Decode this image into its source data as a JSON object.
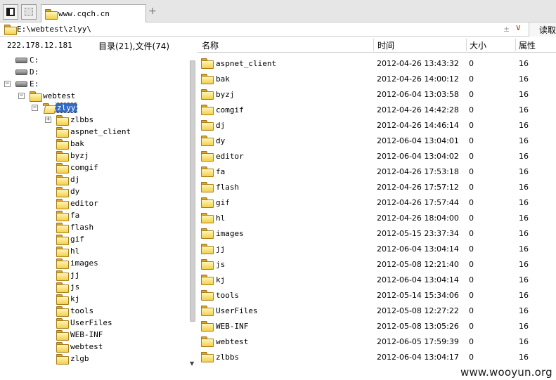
{
  "tab": {
    "label": "www.cqch.cn",
    "add_symbol": "+"
  },
  "address": {
    "path": "E:\\webtest\\zlyy\\",
    "pm_symbol": "±",
    "dropdown_symbol": "∨",
    "read_button": "读取"
  },
  "left": {
    "ip": "222.178.12.181",
    "counts": "目录(21),文件(74)",
    "drives": [
      {
        "label": "C:",
        "expanded": false
      },
      {
        "label": "D:",
        "expanded": false
      },
      {
        "label": "E:",
        "expanded": true
      }
    ],
    "webtest_label": "webtest",
    "selected_folder": "zlyy",
    "children": [
      "zlbbs",
      "aspnet_client",
      "bak",
      "byzj",
      "comgif",
      "dj",
      "dy",
      "editor",
      "fa",
      "flash",
      "gif",
      "hl",
      "images",
      "jj",
      "js",
      "kj",
      "tools",
      "UserFiles",
      "WEB-INF",
      "webtest",
      "zlgb"
    ]
  },
  "columns": {
    "name": "名称",
    "time": "时间",
    "size": "大小",
    "attr": "属性"
  },
  "files": [
    {
      "name": "aspnet_client",
      "time": "2012-04-26 13:43:32",
      "size": "0",
      "attr": "16"
    },
    {
      "name": "bak",
      "time": "2012-04-26 14:00:12",
      "size": "0",
      "attr": "16"
    },
    {
      "name": "byzj",
      "time": "2012-06-04 13:03:58",
      "size": "0",
      "attr": "16"
    },
    {
      "name": "comgif",
      "time": "2012-04-26 14:42:28",
      "size": "0",
      "attr": "16"
    },
    {
      "name": "dj",
      "time": "2012-04-26 14:46:14",
      "size": "0",
      "attr": "16"
    },
    {
      "name": "dy",
      "time": "2012-06-04 13:04:01",
      "size": "0",
      "attr": "16"
    },
    {
      "name": "editor",
      "time": "2012-06-04 13:04:02",
      "size": "0",
      "attr": "16"
    },
    {
      "name": "fa",
      "time": "2012-04-26 17:53:18",
      "size": "0",
      "attr": "16"
    },
    {
      "name": "flash",
      "time": "2012-04-26 17:57:12",
      "size": "0",
      "attr": "16"
    },
    {
      "name": "gif",
      "time": "2012-04-26 17:57:44",
      "size": "0",
      "attr": "16"
    },
    {
      "name": "hl",
      "time": "2012-04-26 18:04:00",
      "size": "0",
      "attr": "16"
    },
    {
      "name": "images",
      "time": "2012-05-15 23:37:34",
      "size": "0",
      "attr": "16"
    },
    {
      "name": "jj",
      "time": "2012-06-04 13:04:14",
      "size": "0",
      "attr": "16"
    },
    {
      "name": "js",
      "time": "2012-05-08 12:21:40",
      "size": "0",
      "attr": "16"
    },
    {
      "name": "kj",
      "time": "2012-06-04 13:04:14",
      "size": "0",
      "attr": "16"
    },
    {
      "name": "tools",
      "time": "2012-05-14 15:34:06",
      "size": "0",
      "attr": "16"
    },
    {
      "name": "UserFiles",
      "time": "2012-05-08 12:27:22",
      "size": "0",
      "attr": "16"
    },
    {
      "name": "WEB-INF",
      "time": "2012-05-08 13:05:26",
      "size": "0",
      "attr": "16"
    },
    {
      "name": "webtest",
      "time": "2012-06-05 17:59:39",
      "size": "0",
      "attr": "16"
    },
    {
      "name": "zlbbs",
      "time": "2012-06-04 13:04:17",
      "size": "0",
      "attr": "16"
    }
  ],
  "watermark": "www.wooyun.org"
}
